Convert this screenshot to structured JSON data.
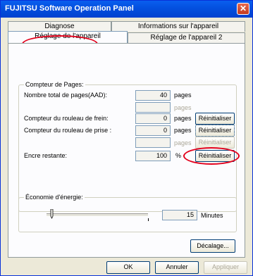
{
  "window": {
    "title": "FUJITSU Software Operation Panel",
    "close_glyph": "✕"
  },
  "tabs": {
    "row_back": [
      {
        "label": "Diagnose"
      },
      {
        "label": "Informations sur l'appareil"
      }
    ],
    "row_front": [
      {
        "label": "Réglage de l'appareil"
      },
      {
        "label": "Réglage de l'appareil 2"
      }
    ]
  },
  "counters": {
    "group_label": "Compteur de Pages:",
    "total": {
      "label": "Nombre total de pages(AAD):",
      "value": "40",
      "unit": "pages"
    },
    "total_blank": {
      "value": "",
      "unit": "pages"
    },
    "brake_roll": {
      "label": "Compteur du rouleau de frein:",
      "value": "0",
      "unit": "pages",
      "button": "Réinitialiser"
    },
    "pick_roll": {
      "label": "Compteur du rouleau de prise :",
      "value": "0",
      "unit": "pages",
      "button": "Réinitialiser"
    },
    "pick_blank": {
      "value": "",
      "unit": "pages",
      "button": "Réinitialiser"
    },
    "ink": {
      "label": "Encre restante:",
      "value": "100",
      "unit": "%",
      "button": "Réinitialiser"
    }
  },
  "energy": {
    "group_label": "Économie d'énergie:",
    "value": "15",
    "unit": "Minutes",
    "slider_fraction": 0.05
  },
  "offset_button": "Décalage...",
  "footer": {
    "ok": "OK",
    "cancel": "Annuler",
    "apply": "Appliquer"
  },
  "colors": {
    "annotation": "#e3001b",
    "titlebar": "#0451e0"
  }
}
